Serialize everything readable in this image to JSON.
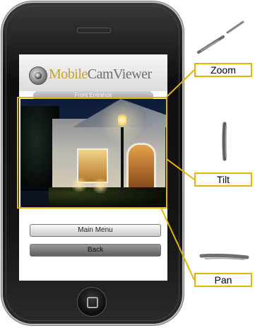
{
  "app": {
    "title_part1": "Mobile",
    "title_part2": "CamViewer",
    "camera_name": "Front Entrance"
  },
  "buttons": {
    "main_menu": "Main Menu",
    "back": "Back"
  },
  "callouts": {
    "zoom": "Zoom",
    "tilt": "Tilt",
    "pan": "Pan"
  },
  "colors": {
    "highlight": "#e8b400",
    "title_gold": "#c9a227",
    "title_gray": "#6e6e6e"
  },
  "icons": {
    "logo": "camera-lens-icon",
    "zoom_gesture": "pinch-stroke-icon",
    "tilt_gesture": "vertical-stroke-icon",
    "pan_gesture": "horizontal-stroke-icon"
  }
}
